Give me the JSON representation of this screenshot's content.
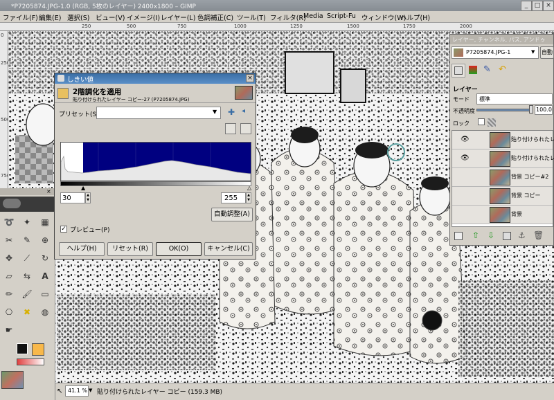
{
  "window": {
    "title": "*P7205874.JPG-1.0 (RGB, 5枚のレイヤー) 2400x1800 – GIMP"
  },
  "menu": [
    "ファイル(F)",
    "編集(E)",
    "選択(S)",
    "ビュー(V)",
    "イメージ(I)",
    "レイヤー(L)",
    "色調補正(C)",
    "ツール(T)",
    "フィルタ(R)",
    "Media",
    "Script-Fu",
    "ウィンドウ(W)",
    "ヘルプ(H)"
  ],
  "ruler": {
    "top": [
      "250",
      "500",
      "750",
      "1000",
      "1250",
      "1500",
      "1750",
      "2000"
    ],
    "left": [
      "0",
      "250",
      "500",
      "750"
    ]
  },
  "dialog": {
    "title": "しきい値",
    "heading": "2階調化を適用",
    "subheading": "貼り付けられたレイヤー コピー-27 (P7205874.JPG)",
    "preset_label": "プリセット(S):",
    "preset_value": "",
    "low": "30",
    "high": "255",
    "auto_button": "自動調整(A)",
    "preview_label": "プレビュー(P)",
    "preview_checked": true,
    "buttons": [
      "ヘルプ(H)",
      "リセット(R)",
      "OK(O)",
      "キャンセル(C)"
    ],
    "histogram_fill": "#000080",
    "threshold_low_fraction": 0.118
  },
  "dock": {
    "title": "レイヤー, チャンネル, パス, アンドゥ",
    "image_select": "P7205874.JPG-1",
    "auto_label": "自動",
    "section_label": "レイヤー",
    "mode_label": "モード",
    "mode_value": "標準",
    "opacity_label": "不透明度",
    "opacity_value": "100.0",
    "lock_label": "ロック",
    "layers": [
      {
        "name": "貼り付けられたレイヤー",
        "visible": true
      },
      {
        "name": "貼り付けられたレイヤー",
        "visible": true
      },
      {
        "name": "背景 コピー#2",
        "visible": false
      },
      {
        "name": "背景 コピー",
        "visible": false
      },
      {
        "name": "背景",
        "visible": false
      }
    ]
  },
  "status": {
    "zoom": "41.1 %",
    "info": "貼り付けられたレイヤー コピー (159.3 MB)"
  }
}
